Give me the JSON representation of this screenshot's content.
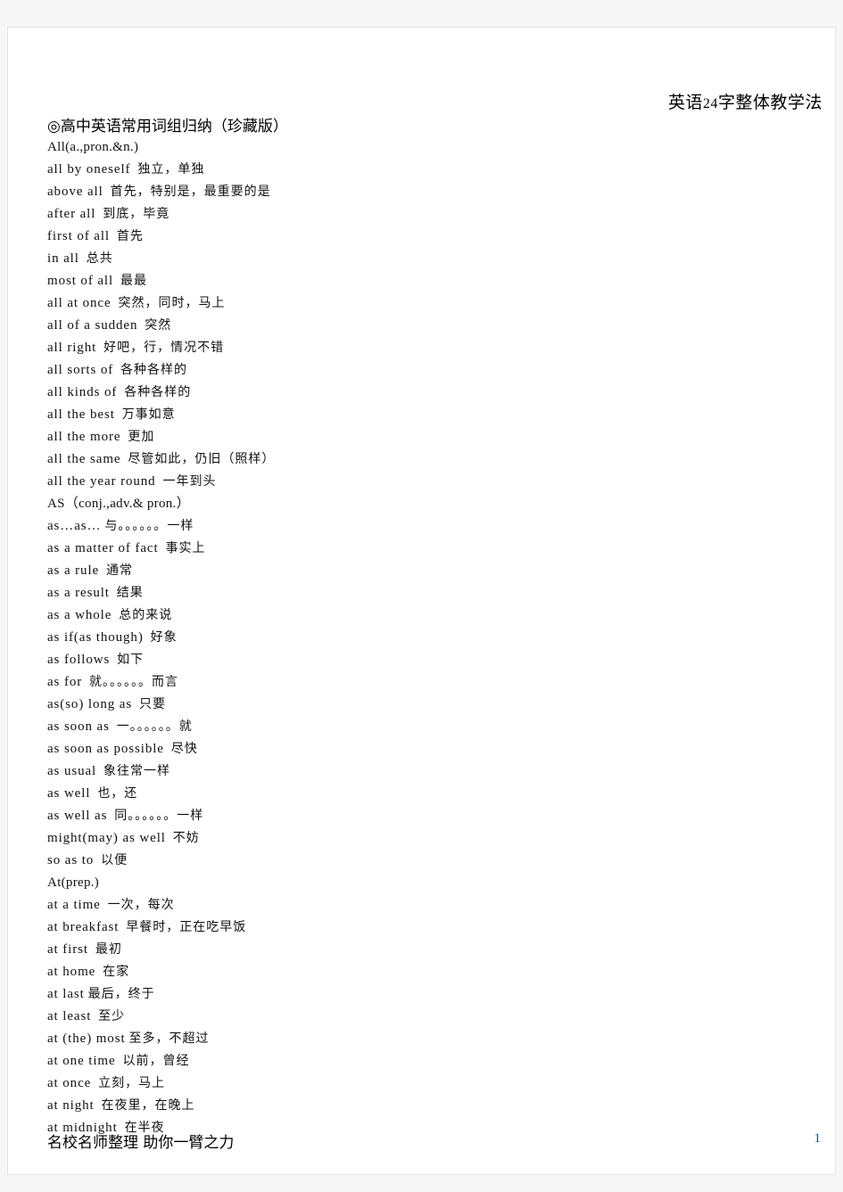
{
  "header": {
    "text_before": "英语",
    "number": "24",
    "text_after": "字整体教学法",
    "full": "英语 24 字整体教学法"
  },
  "document": {
    "title": "◎高中英语常用词组归纳（珍藏版）",
    "footer": "名校名师整理  助你一臂之力",
    "page_number": "1"
  },
  "entries": [
    {
      "en": "All(a.,pron.&n.)",
      "cn": "",
      "heading": true
    },
    {
      "en": "all by oneself",
      "cn": "独立，单独"
    },
    {
      "en": "above all",
      "cn": "首先，特别是，最重要的是"
    },
    {
      "en": "after all",
      "cn": "到底，毕竟"
    },
    {
      "en": "first of all",
      "cn": "首先"
    },
    {
      "en": "in all",
      "cn": "总共"
    },
    {
      "en": "most of all",
      "cn": "最最"
    },
    {
      "en": "all at once",
      "cn": "突然，同时，马上"
    },
    {
      "en": "all of a sudden",
      "cn": "突然"
    },
    {
      "en": "all right",
      "cn": "好吧，行，情况不错"
    },
    {
      "en": "all sorts of",
      "cn": "各种各样的"
    },
    {
      "en": "all kinds of",
      "cn": "各种各样的"
    },
    {
      "en": "all the best",
      "cn": "万事如意"
    },
    {
      "en": "all the more",
      "cn": "更加"
    },
    {
      "en": "all the same",
      "cn": "尽管如此，仍旧（照样）"
    },
    {
      "en": "all the year round",
      "cn": "一年到头"
    },
    {
      "en": "AS（conj.,adv.& pron.）",
      "cn": "",
      "heading": true
    },
    {
      "en": "as…as…",
      "cn": "与。。。。。。一样",
      "tight": true
    },
    {
      "en": "as a matter of fact",
      "cn": "事实上"
    },
    {
      "en": "as a rule",
      "cn": "通常"
    },
    {
      "en": "as a result",
      "cn": "结果"
    },
    {
      "en": "as a whole",
      "cn": "总的来说"
    },
    {
      "en": "as if(as though)",
      "cn": "好象"
    },
    {
      "en": "as follows",
      "cn": "如下"
    },
    {
      "en": "as for",
      "cn": "就。。。。。。而言"
    },
    {
      "en": "as(so) long as",
      "cn": "只要"
    },
    {
      "en": "as soon as",
      "cn": "一。。。。。。就"
    },
    {
      "en": "as soon as possible",
      "cn": "尽快"
    },
    {
      "en": "as usual",
      "cn": "象往常一样"
    },
    {
      "en": "as well",
      "cn": "也，还"
    },
    {
      "en": "as well as",
      "cn": "同。。。。。。一样"
    },
    {
      "en": "might(may) as well",
      "cn": "不妨"
    },
    {
      "en": "so as to",
      "cn": "以便"
    },
    {
      "en": "At(prep.)",
      "cn": "",
      "heading": true
    },
    {
      "en": "at a time",
      "cn": "一次，每次"
    },
    {
      "en": "at breakfast",
      "cn": "早餐时，正在吃早饭"
    },
    {
      "en": "at first",
      "cn": "最初"
    },
    {
      "en": "at home",
      "cn": "在家"
    },
    {
      "en": "at last",
      "cn": "最后，终于",
      "tight": true
    },
    {
      "en": "at least",
      "cn": "至少"
    },
    {
      "en": "at (the) most",
      "cn": "至多，不超过",
      "tight": true
    },
    {
      "en": "at one time",
      "cn": "以前，曾经"
    },
    {
      "en": "at once",
      "cn": "立刻，马上"
    },
    {
      "en": "at night",
      "cn": "在夜里，在晚上"
    },
    {
      "en": "at midnight",
      "cn": "在半夜"
    }
  ]
}
